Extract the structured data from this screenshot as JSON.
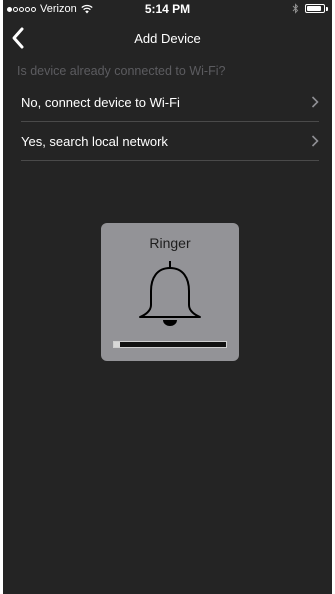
{
  "status_bar": {
    "carrier": "Verizon",
    "signal_strength": 1,
    "signal_max": 5,
    "time": "5:14 PM",
    "battery_level": 0.85
  },
  "nav": {
    "title": "Add Device",
    "back_icon": "chevron-left-icon"
  },
  "question": "Is device already connected to Wi-Fi?",
  "options": [
    {
      "label": "No, connect device to Wi-Fi",
      "icon": "chevron-right-icon"
    },
    {
      "label": "Yes, search local network",
      "icon": "chevron-right-icon"
    }
  ],
  "device": {
    "name": "Ringer",
    "icon": "bell-icon",
    "progress": 0.05
  },
  "colors": {
    "background": "#242424",
    "card": "#939397",
    "muted_text": "#5c5c60",
    "divider": "#4a4a4a"
  }
}
